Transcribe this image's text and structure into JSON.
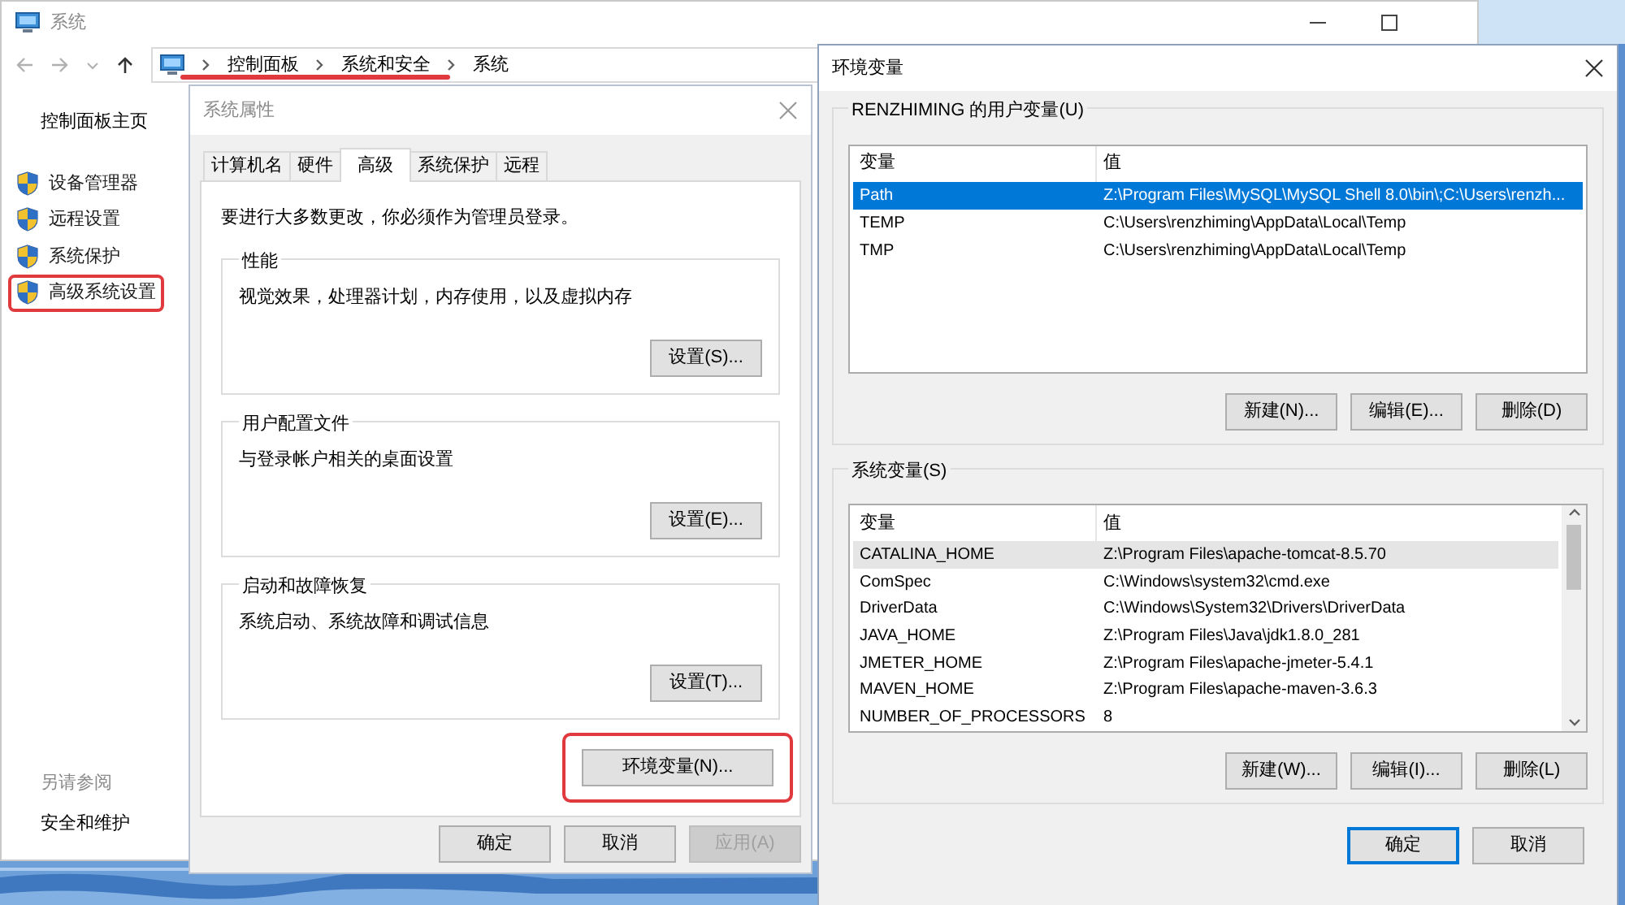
{
  "explorer": {
    "title": "系统",
    "breadcrumb": {
      "annotated": true,
      "parts": [
        "控制面板",
        "系统和安全",
        "系统"
      ]
    },
    "sidebar": {
      "home": "控制面板主页",
      "items": [
        {
          "label": "设备管理器",
          "annotated": false
        },
        {
          "label": "远程设置",
          "annotated": false
        },
        {
          "label": "系统保护",
          "annotated": false
        },
        {
          "label": "高级系统设置",
          "annotated": true
        }
      ],
      "see_also_heading": "另请参阅",
      "see_also_links": [
        "安全和维护"
      ]
    }
  },
  "system_properties": {
    "title": "系统属性",
    "tabs": [
      {
        "label": "计算机名",
        "selected": false
      },
      {
        "label": "硬件",
        "selected": false
      },
      {
        "label": "高级",
        "selected": true
      },
      {
        "label": "系统保护",
        "selected": false
      },
      {
        "label": "远程",
        "selected": false
      }
    ],
    "notice": "要进行大多数更改，你必须作为管理员登录。",
    "groups": [
      {
        "title": "性能",
        "description": "视觉效果，处理器计划，内存使用，以及虚拟内存",
        "button": "设置(S)..."
      },
      {
        "title": "用户配置文件",
        "description": "与登录帐户相关的桌面设置",
        "button": "设置(E)..."
      },
      {
        "title": "启动和故障恢复",
        "description": "系统启动、系统故障和调试信息",
        "button": "设置(T)..."
      }
    ],
    "env_button": {
      "label": "环境变量(N)...",
      "annotated": true
    },
    "buttons": [
      {
        "label": "确定",
        "disabled": false
      },
      {
        "label": "取消",
        "disabled": false
      },
      {
        "label": "应用(A)",
        "disabled": true
      }
    ]
  },
  "env_dialog": {
    "title": "环境变量",
    "user_vars": {
      "title": "RENZHIMING 的用户变量(U)",
      "focused": true,
      "columns": [
        "变量",
        "值"
      ],
      "rows": [
        {
          "name": "Path",
          "value": "Z:\\Program Files\\MySQL\\MySQL Shell 8.0\\bin\\;C:\\Users\\renzh...",
          "selected": true
        },
        {
          "name": "TEMP",
          "value": "C:\\Users\\renzhiming\\AppData\\Local\\Temp",
          "selected": false
        },
        {
          "name": "TMP",
          "value": "C:\\Users\\renzhiming\\AppData\\Local\\Temp",
          "selected": false
        }
      ],
      "buttons": [
        "新建(N)...",
        "编辑(E)...",
        "删除(D)"
      ]
    },
    "system_vars": {
      "title": "系统变量(S)",
      "focused": false,
      "columns": [
        "变量",
        "值"
      ],
      "rows": [
        {
          "name": "CATALINA_HOME",
          "value": "Z:\\Program Files\\apache-tomcat-8.5.70",
          "selected": true
        },
        {
          "name": "ComSpec",
          "value": "C:\\Windows\\system32\\cmd.exe",
          "selected": false
        },
        {
          "name": "DriverData",
          "value": "C:\\Windows\\System32\\Drivers\\DriverData",
          "selected": false
        },
        {
          "name": "JAVA_HOME",
          "value": "Z:\\Program Files\\Java\\jdk1.8.0_281",
          "selected": false
        },
        {
          "name": "JMETER_HOME",
          "value": "Z:\\Program Files\\apache-jmeter-5.4.1",
          "selected": false
        },
        {
          "name": "MAVEN_HOME",
          "value": "Z:\\Program Files\\apache-maven-3.6.3",
          "selected": false
        },
        {
          "name": "NUMBER_OF_PROCESSORS",
          "value": "8",
          "selected": false
        }
      ],
      "buttons": [
        "新建(W)...",
        "编辑(I)...",
        "删除(L)"
      ]
    },
    "buttons": [
      {
        "label": "确定",
        "default": true
      },
      {
        "label": "取消",
        "default": false
      }
    ]
  }
}
